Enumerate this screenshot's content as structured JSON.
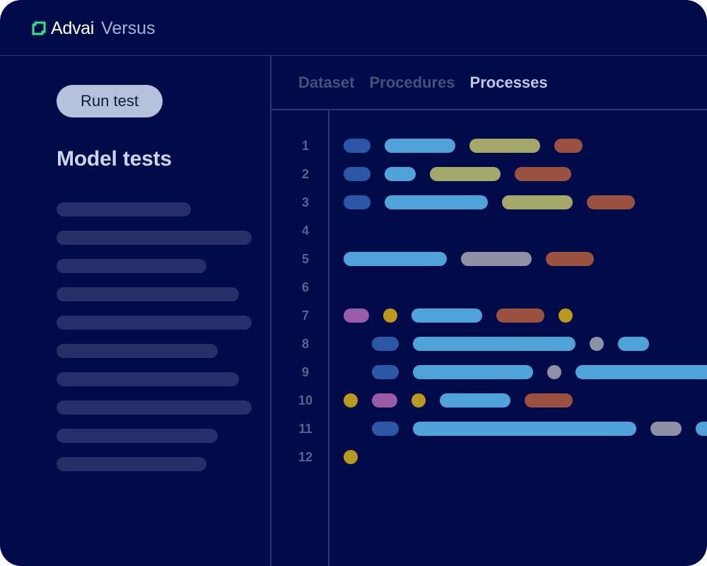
{
  "app": {
    "brand": "Advai",
    "product": "Versus",
    "logo_icon": "advai-logo-icon",
    "accent_color": "#2ee88a",
    "background_color": "#020b4a"
  },
  "sidebar": {
    "run_button_label": "Run test",
    "title": "Model tests",
    "placeholder_rows": 10
  },
  "tabs": [
    {
      "label": "Dataset",
      "active": false
    },
    {
      "label": "Procedures",
      "active": false
    },
    {
      "label": "Processes",
      "active": true
    }
  ],
  "editor": {
    "line_numbers": [
      "1",
      "2",
      "3",
      "4",
      "5",
      "6",
      "7",
      "8",
      "9",
      "10",
      "11",
      "12"
    ],
    "token_colors": {
      "navy": "#2b57a6",
      "blue": "#4fa3d8",
      "olive": "#a4a86b",
      "rust": "#9a5140",
      "grey": "#8e91a6",
      "purple": "#9a5bab",
      "gold": "#b99a1f"
    }
  }
}
